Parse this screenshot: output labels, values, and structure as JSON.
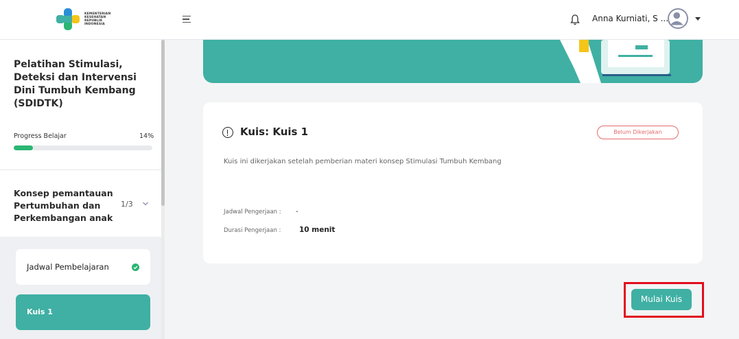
{
  "header": {
    "logo_lines": [
      "KEMENTERIAN",
      "KESEHATAN",
      "REPUBLIK",
      "INDONESIA"
    ],
    "user_name": "Anna Kurniati, S ...",
    "icons": {
      "menu": "hamburger-icon",
      "notification": "bell-icon",
      "avatar": "user-avatar-icon",
      "dropdown": "caret-down-icon"
    }
  },
  "sidebar": {
    "course_title": "Pelatihan Stimulasi, Deteksi dan Intervensi Dini Tumbuh Kembang (SDIDTK)",
    "progress": {
      "label": "Progress Belajar",
      "percent_text": "14%",
      "value": 14
    },
    "module": {
      "title": "Konsep pemantauan Pertumbuhan dan Perkembangan anak",
      "count": "1/3"
    },
    "items": [
      {
        "label": "Jadwal Pembelajaran",
        "completed": true
      },
      {
        "label": "Kuis 1",
        "active": true
      }
    ]
  },
  "quiz": {
    "title": "Kuis: Kuis 1",
    "status": "Belum Dikerjakan",
    "description": "Kuis ini dikerjakan setelah pemberian materi konsep Stimulasi Tumbuh Kembang",
    "schedule_label": "Jadwal Pengerjaan  :",
    "schedule_value": "-",
    "duration_label": "Durasi Pengerjaan   :",
    "duration_value": "10 menit",
    "start_button": "Mulai Kuis"
  },
  "colors": {
    "primary": "#3fb0a3",
    "success": "#2bb673",
    "danger": "#e46b6b",
    "highlight": "#e30d1b"
  }
}
